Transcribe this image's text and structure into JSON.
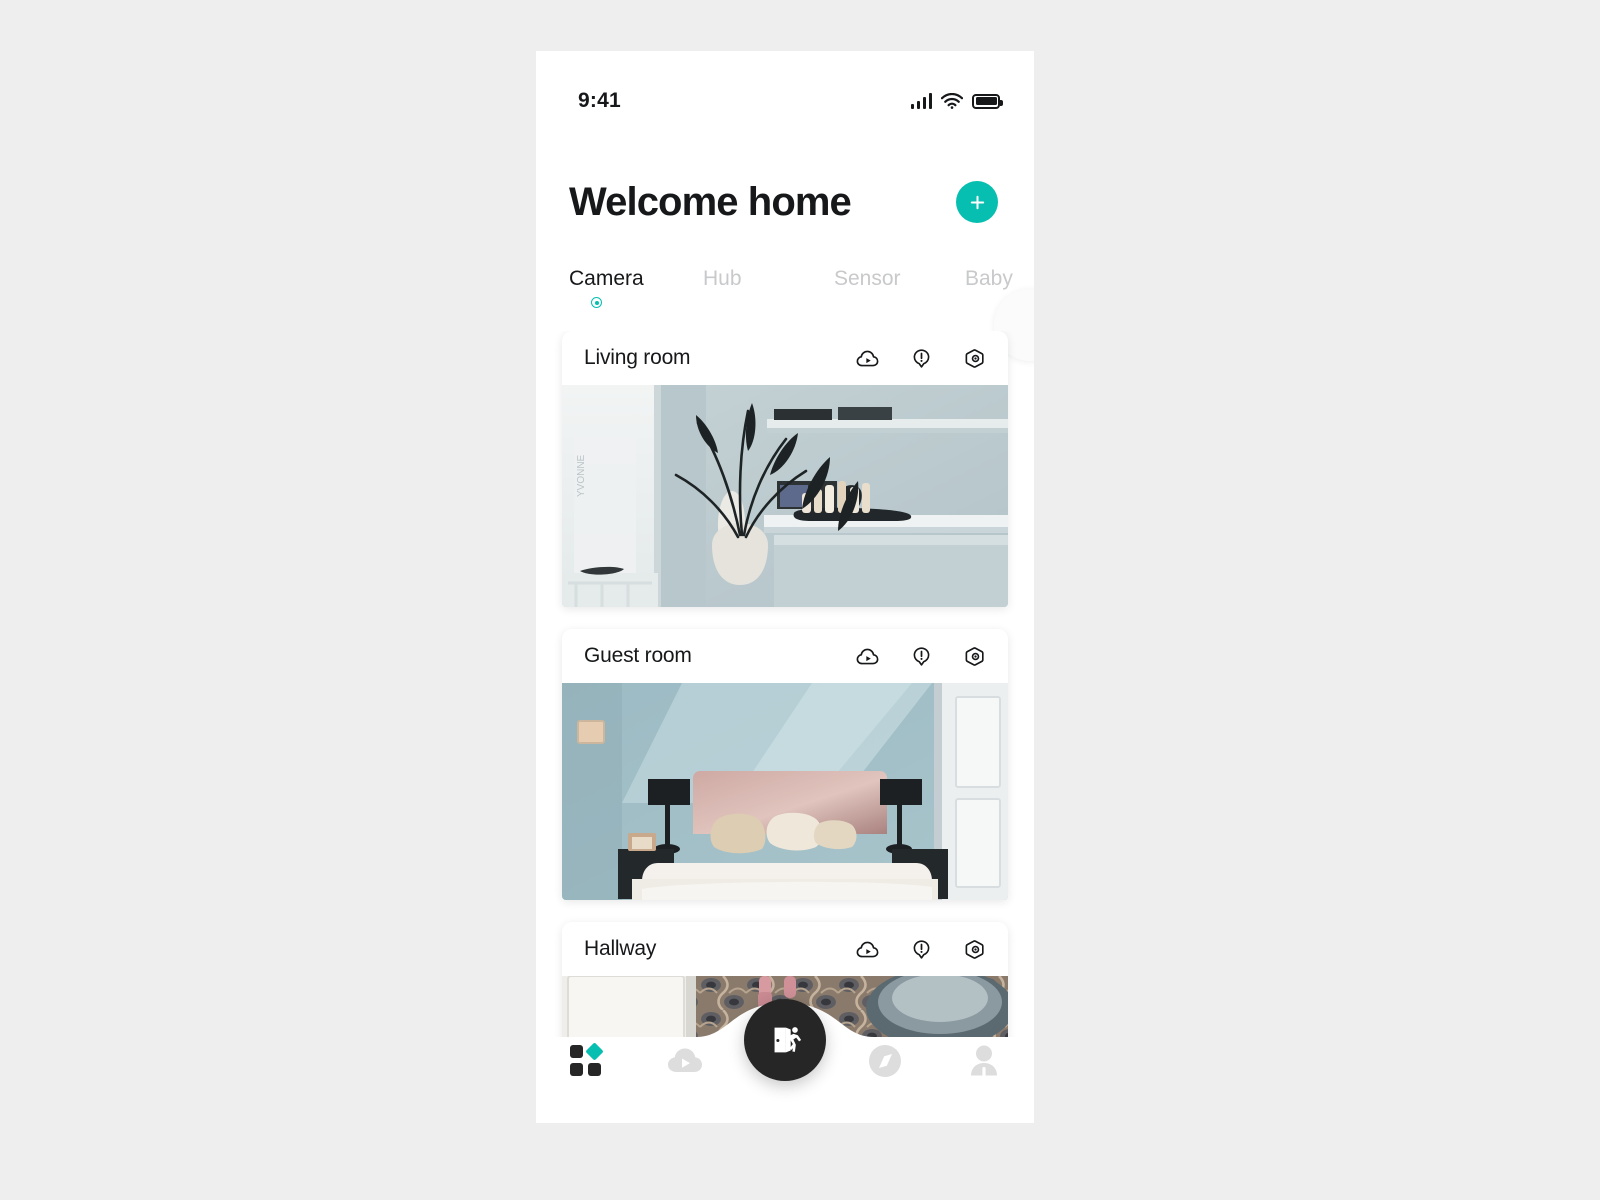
{
  "app": {
    "accent_color": "#07bfb0",
    "dark_color": "#262626",
    "muted_color": "#c8c9cb"
  },
  "status_bar": {
    "time": "9:41",
    "signal_icon": "signal-bars-icon",
    "wifi_icon": "wifi-icon",
    "battery_icon": "battery-full-icon"
  },
  "header": {
    "title": "Welcome home",
    "add_button_label": "+",
    "add_button_icon": "plus-icon"
  },
  "tabs": {
    "items": [
      {
        "label": "Camera",
        "active": true
      },
      {
        "label": "Hub",
        "active": false
      },
      {
        "label": "Sensor",
        "active": false
      },
      {
        "label": "Baby",
        "active": false
      }
    ]
  },
  "cards": [
    {
      "title": "Living room",
      "actions": [
        {
          "icon": "cloud-play-icon",
          "name": "cloud-recording-button"
        },
        {
          "icon": "alert-pin-icon",
          "name": "alerts-button"
        },
        {
          "icon": "hex-settings-icon",
          "name": "camera-settings-button"
        }
      ],
      "photo_alt": "living-room-camera-feed"
    },
    {
      "title": "Guest room",
      "actions": [
        {
          "icon": "cloud-play-icon",
          "name": "cloud-recording-button"
        },
        {
          "icon": "alert-pin-icon",
          "name": "alerts-button"
        },
        {
          "icon": "hex-settings-icon",
          "name": "camera-settings-button"
        }
      ],
      "photo_alt": "guest-room-camera-feed"
    },
    {
      "title": "Hallway",
      "actions": [
        {
          "icon": "cloud-play-icon",
          "name": "cloud-recording-button"
        },
        {
          "icon": "alert-pin-icon",
          "name": "alerts-button"
        },
        {
          "icon": "hex-settings-icon",
          "name": "camera-settings-button"
        }
      ],
      "photo_alt": "hallway-camera-feed"
    }
  ],
  "bottom_nav": {
    "items": [
      {
        "icon": "grid-dashboard-icon",
        "name": "nav-dashboard",
        "active": true
      },
      {
        "icon": "cloud-play-icon",
        "name": "nav-recordings",
        "active": false
      },
      {
        "icon": "compass-icon",
        "name": "nav-explore",
        "active": false
      },
      {
        "icon": "person-icon",
        "name": "nav-profile",
        "active": false
      }
    ],
    "fab": {
      "icon": "door-exit-icon",
      "name": "leave-home-button"
    }
  }
}
